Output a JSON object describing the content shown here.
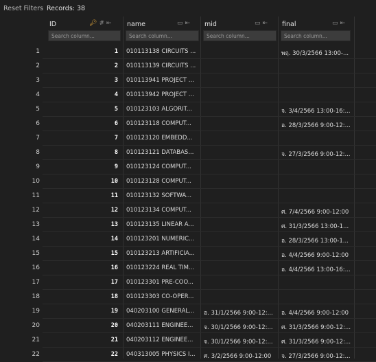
{
  "toolbar": {
    "reset_label": "Reset Filters",
    "records_label": "Records: 38"
  },
  "columns": [
    {
      "key": "id",
      "label": "ID",
      "placeholder": "Search column..."
    },
    {
      "key": "name",
      "label": "name",
      "placeholder": "Search column..."
    },
    {
      "key": "mid",
      "label": "mid",
      "placeholder": "Search column..."
    },
    {
      "key": "final",
      "label": "final",
      "placeholder": "Search column..."
    }
  ],
  "icons": {
    "id": [
      "key-icon",
      "hash-icon",
      "pin-icon"
    ],
    "other": [
      "type-icon",
      "pin-icon"
    ]
  },
  "rows": [
    {
      "n": "1",
      "id": "1",
      "name": "010113138 CIRCUITS ...",
      "mid": "",
      "final": "พฤ. 30/3/2566 13:00-..."
    },
    {
      "n": "2",
      "id": "2",
      "name": "010113139 CIRCUITS ...",
      "mid": "",
      "final": ""
    },
    {
      "n": "3",
      "id": "3",
      "name": "010113941 PROJECT ...",
      "mid": "",
      "final": ""
    },
    {
      "n": "4",
      "id": "4",
      "name": "010113942 PROJECT ...",
      "mid": "",
      "final": ""
    },
    {
      "n": "5",
      "id": "5",
      "name": "010123103 ALGORIT...",
      "mid": "",
      "final": "จ. 3/4/2566 13:00-16:..."
    },
    {
      "n": "6",
      "id": "6",
      "name": "010123118 COMPUT...",
      "mid": "",
      "final": "อ. 28/3/2566 9:00-12:..."
    },
    {
      "n": "7",
      "id": "7",
      "name": "010123120 EMBEDD...",
      "mid": "",
      "final": ""
    },
    {
      "n": "8",
      "id": "8",
      "name": "010123121 DATABAS...",
      "mid": "",
      "final": "จ. 27/3/2566 9:00-12:..."
    },
    {
      "n": "9",
      "id": "9",
      "name": "010123124 COMPUT...",
      "mid": "",
      "final": ""
    },
    {
      "n": "10",
      "id": "10",
      "name": "010123128 COMPUT...",
      "mid": "",
      "final": ""
    },
    {
      "n": "11",
      "id": "11",
      "name": "010123132 SOFTWA...",
      "mid": "",
      "final": ""
    },
    {
      "n": "12",
      "id": "12",
      "name": "010123134 COMPUT...",
      "mid": "",
      "final": "ศ. 7/4/2566 9:00-12:00"
    },
    {
      "n": "13",
      "id": "13",
      "name": "010123135 LINEAR A...",
      "mid": "",
      "final": "ศ. 31/3/2566 13:00-1..."
    },
    {
      "n": "14",
      "id": "14",
      "name": "010123201 NUMERIC...",
      "mid": "",
      "final": "อ. 28/3/2566 13:00-1..."
    },
    {
      "n": "15",
      "id": "15",
      "name": "010123213 ARTIFICIA...",
      "mid": "",
      "final": "อ. 4/4/2566 9:00-12:00"
    },
    {
      "n": "16",
      "id": "16",
      "name": "010123224 REAL TIM...",
      "mid": "",
      "final": "อ. 4/4/2566 13:00-16:..."
    },
    {
      "n": "17",
      "id": "17",
      "name": "010123301 PRE-COO...",
      "mid": "",
      "final": ""
    },
    {
      "n": "18",
      "id": "18",
      "name": "010123303 CO-OPER...",
      "mid": "",
      "final": ""
    },
    {
      "n": "19",
      "id": "19",
      "name": "040203100 GENERAL...",
      "mid": "อ. 31/1/2566 9:00-12:...",
      "final": "อ. 4/4/2566 9:00-12:00"
    },
    {
      "n": "20",
      "id": "20",
      "name": "040203111 ENGINEE...",
      "mid": "จ. 30/1/2566 9:00-12:...",
      "final": "ศ. 31/3/2566 9:00-12:..."
    },
    {
      "n": "21",
      "id": "21",
      "name": "040203112 ENGINEE...",
      "mid": "จ. 30/1/2566 9:00-12:...",
      "final": "ศ. 31/3/2566 9:00-12:..."
    },
    {
      "n": "22",
      "id": "22",
      "name": "040313005 PHYSICS I...",
      "mid": "ศ. 3/2/2566 9:00-12:00",
      "final": "จ. 27/3/2566 9:00-12:..."
    }
  ]
}
